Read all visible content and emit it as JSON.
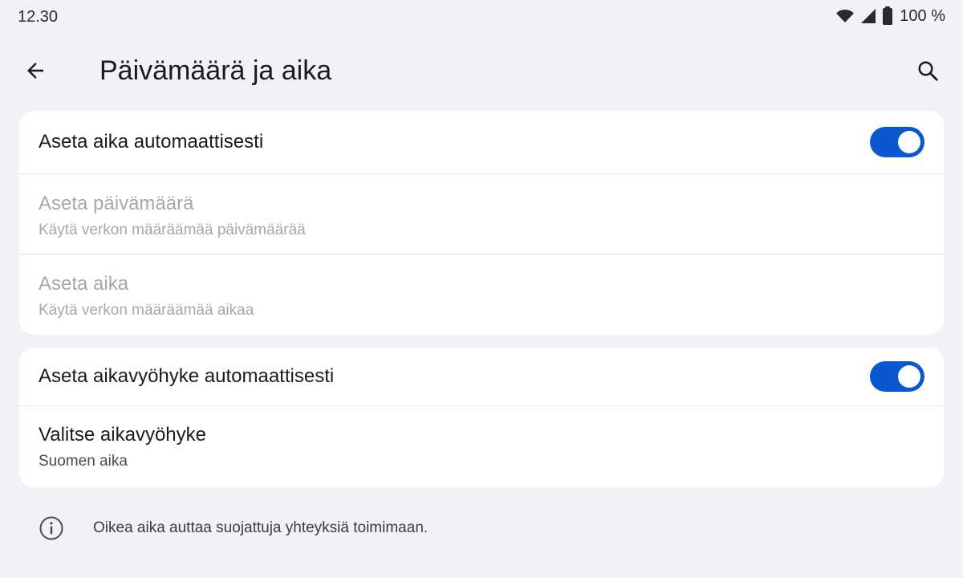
{
  "status_bar": {
    "time": "12.30",
    "battery_text": "100 %",
    "icons": [
      "wifi-icon",
      "signal-icon",
      "battery-icon"
    ]
  },
  "app_bar": {
    "title": "Päivämäärä ja aika",
    "back_icon": "arrow-back-icon",
    "search_icon": "search-icon"
  },
  "card_datetime": {
    "auto_time": {
      "title": "Aseta aika automaattisesti",
      "enabled": true
    },
    "set_date": {
      "title": "Aseta päivämäärä",
      "subtitle": "Käytä verkon määräämää päivämäärää",
      "disabled": true
    },
    "set_time": {
      "title": "Aseta aika",
      "subtitle": "Käytä verkon määräämää aikaa",
      "disabled": true
    }
  },
  "card_timezone": {
    "auto_timezone": {
      "title": "Aseta aikavyöhyke automaattisesti",
      "enabled": true
    },
    "select_timezone": {
      "title": "Valitse aikavyöhyke",
      "subtitle": "Suomen aika"
    }
  },
  "footer": {
    "icon": "info-icon",
    "text": "Oikea aika auttaa suojattuja yhteyksiä toimimaan."
  },
  "colors": {
    "accent": "#0b57d0",
    "background": "#f2f2f6",
    "card": "#ffffff",
    "disabled_text": "#a7a7ab"
  }
}
